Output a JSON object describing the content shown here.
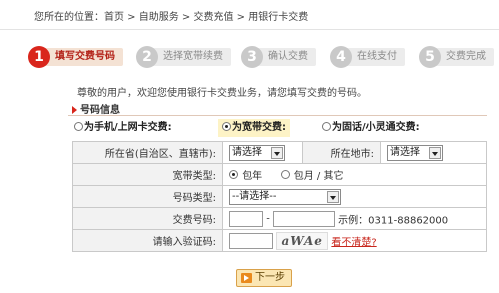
{
  "breadcrumb": "您所在的位置：首页 > 自助服务 > 交费充值 > 用银行卡交费",
  "steps": [
    {
      "num": "1",
      "label": "填写交费号码"
    },
    {
      "num": "2",
      "label": "选择宽带续费"
    },
    {
      "num": "3",
      "label": "确认交费"
    },
    {
      "num": "4",
      "label": "在线支付"
    },
    {
      "num": "5",
      "label": "交费完成"
    }
  ],
  "welcome": "尊敬的用户，欢迎您使用银行卡交费业务，请您填写交费的号码。",
  "section_title": "号码信息",
  "payment_types": [
    {
      "label": "为手机/上网卡交费:",
      "checked": false
    },
    {
      "label": "为宽带交费:",
      "checked": true
    },
    {
      "label": "为固话/小灵通交费:",
      "checked": false
    }
  ],
  "form": {
    "province_label": "所在省(自治区、直辖市):",
    "province_value": "请选择",
    "city_label": "所在地市:",
    "city_value": "请选择",
    "broadband_type_label": "宽带类型:",
    "broadband_options": [
      "包年",
      "包月 / 其它"
    ],
    "number_type_label": "号码类型:",
    "number_type_value": "--请选择--",
    "payment_number_label": "交费号码:",
    "payment_number_dash": "-",
    "payment_number_example": "示例：0311-88862000",
    "captcha_label": "请输入验证码:",
    "captcha_text": "aWAe",
    "captcha_link": "看不清楚?"
  },
  "next_button": "下一步",
  "colors": {
    "accent": "#d9261c",
    "step_active_bg": "#f4e2d4",
    "step_inactive_bg": "#ececec"
  }
}
